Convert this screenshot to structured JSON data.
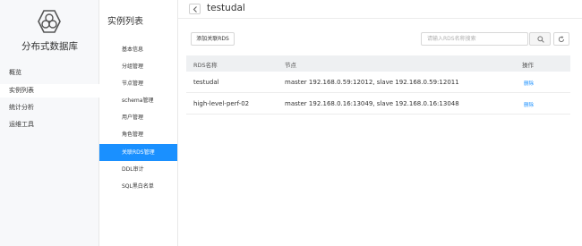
{
  "app": {
    "title": "分布式数据库"
  },
  "sidebar": {
    "items": [
      {
        "label": "概览",
        "active": false
      },
      {
        "label": "实例列表",
        "active": true
      },
      {
        "label": "统计分析",
        "active": false
      },
      {
        "label": "运维工具",
        "active": false
      }
    ]
  },
  "subnav": {
    "title": "实例列表",
    "items": [
      {
        "label": "基本信息",
        "active": false
      },
      {
        "label": "分组管理",
        "active": false
      },
      {
        "label": "节点管理",
        "active": false
      },
      {
        "label": "schema管理",
        "active": false
      },
      {
        "label": "用户管理",
        "active": false
      },
      {
        "label": "角色管理",
        "active": false
      },
      {
        "label": "关联RDS管理",
        "active": true
      },
      {
        "label": "DDL审计",
        "active": false
      },
      {
        "label": "SQL黑白名单",
        "active": false
      }
    ]
  },
  "header": {
    "title": "testudal",
    "back_icon": "chevron-left-icon"
  },
  "toolbar": {
    "add_label": "添加关联RDS",
    "search_placeholder": "请输入RDS名称搜索",
    "search_icon": "search-icon",
    "refresh_icon": "refresh-icon"
  },
  "table": {
    "columns": [
      "RDS名称",
      "节点",
      "操作"
    ],
    "rows": [
      {
        "name": "testudal",
        "nodes": "master 192.168.0.59:12012, slave 192.168.0.59:12011",
        "action": "删除"
      },
      {
        "name": "high-level-perf-02",
        "nodes": "master 192.168.0.16:13049, slave 192.168.0.16:13048",
        "action": "删除"
      }
    ]
  },
  "colors": {
    "accent": "#1a90ff",
    "sidebar_bg": "#f7f8fa",
    "header_bg": "#eef0f2"
  }
}
